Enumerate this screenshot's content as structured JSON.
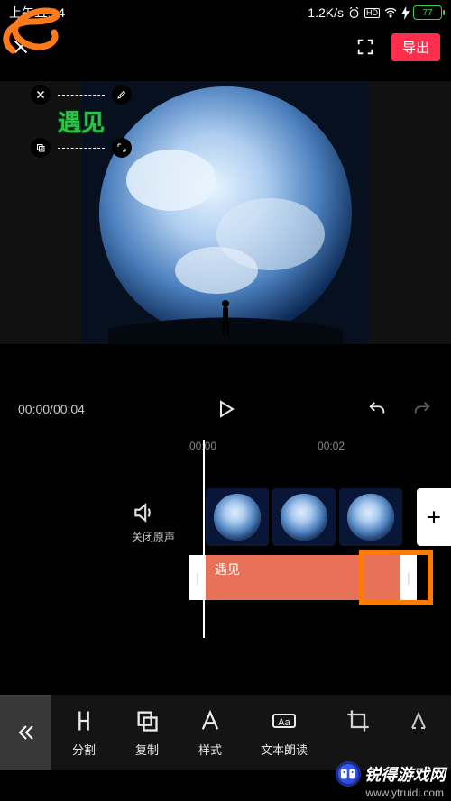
{
  "status": {
    "time": "上午11:14",
    "net_speed": "1.2K/s",
    "battery": "77"
  },
  "topbar": {
    "export_label": "导出"
  },
  "preview": {
    "overlay_text": "遇见"
  },
  "controls": {
    "time_current": "00:00",
    "time_total": "00:04"
  },
  "timeline": {
    "ticks": [
      "00:00",
      "00:02"
    ],
    "mute_label": "关闭原声",
    "caption_text": "遇见"
  },
  "toolbar": {
    "items": [
      {
        "id": "split",
        "label": "分割"
      },
      {
        "id": "copy",
        "label": "复制"
      },
      {
        "id": "style",
        "label": "样式"
      },
      {
        "id": "tts",
        "label": "文本朗读"
      }
    ]
  },
  "watermark": {
    "brand": "锐得游戏网",
    "url": "www.ytruidi.com"
  }
}
